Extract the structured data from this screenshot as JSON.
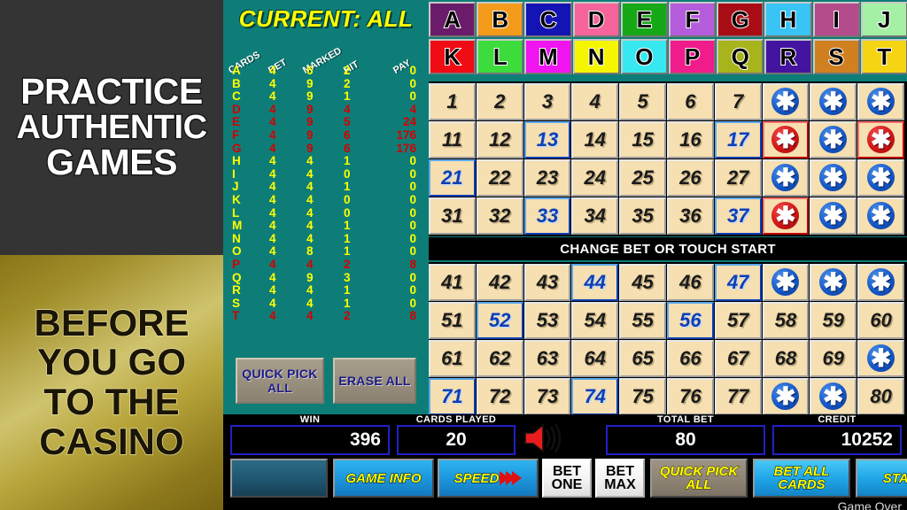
{
  "promo": {
    "top_lines": [
      "PRACTICE",
      "AUTHENTIC",
      "GAMES"
    ],
    "bottom_lines": [
      "BEFORE",
      "YOU GO",
      "TO THE",
      "CASINO"
    ],
    "top_bg": "#343434",
    "bottom_bg": "#b8a63c"
  },
  "paytable": {
    "title": "CURRENT: ALL",
    "headers": [
      "CARDS",
      "BET",
      "MARKED",
      "HIT",
      "PAY"
    ],
    "rows": [
      {
        "card": "A",
        "bet": "4",
        "marked": "6",
        "hit": "2",
        "pay": "0",
        "color": "y"
      },
      {
        "card": "B",
        "bet": "4",
        "marked": "9",
        "hit": "2",
        "pay": "0",
        "color": "y"
      },
      {
        "card": "C",
        "bet": "4",
        "marked": "9",
        "hit": "1",
        "pay": "0",
        "color": "y"
      },
      {
        "card": "D",
        "bet": "4",
        "marked": "9",
        "hit": "4",
        "pay": "4",
        "color": "r"
      },
      {
        "card": "E",
        "bet": "4",
        "marked": "9",
        "hit": "5",
        "pay": "24",
        "color": "r"
      },
      {
        "card": "F",
        "bet": "4",
        "marked": "9",
        "hit": "6",
        "pay": "176",
        "color": "r"
      },
      {
        "card": "G",
        "bet": "4",
        "marked": "9",
        "hit": "6",
        "pay": "176",
        "color": "r"
      },
      {
        "card": "H",
        "bet": "4",
        "marked": "4",
        "hit": "1",
        "pay": "0",
        "color": "y"
      },
      {
        "card": "I",
        "bet": "4",
        "marked": "4",
        "hit": "0",
        "pay": "0",
        "color": "y"
      },
      {
        "card": "J",
        "bet": "4",
        "marked": "4",
        "hit": "1",
        "pay": "0",
        "color": "y"
      },
      {
        "card": "K",
        "bet": "4",
        "marked": "4",
        "hit": "0",
        "pay": "0",
        "color": "y"
      },
      {
        "card": "L",
        "bet": "4",
        "marked": "4",
        "hit": "0",
        "pay": "0",
        "color": "y"
      },
      {
        "card": "M",
        "bet": "4",
        "marked": "4",
        "hit": "1",
        "pay": "0",
        "color": "y"
      },
      {
        "card": "N",
        "bet": "4",
        "marked": "4",
        "hit": "1",
        "pay": "0",
        "color": "y"
      },
      {
        "card": "O",
        "bet": "4",
        "marked": "8",
        "hit": "1",
        "pay": "0",
        "color": "y"
      },
      {
        "card": "P",
        "bet": "4",
        "marked": "4",
        "hit": "2",
        "pay": "8",
        "color": "r"
      },
      {
        "card": "Q",
        "bet": "4",
        "marked": "9",
        "hit": "3",
        "pay": "0",
        "color": "y"
      },
      {
        "card": "R",
        "bet": "4",
        "marked": "4",
        "hit": "1",
        "pay": "0",
        "color": "y"
      },
      {
        "card": "S",
        "bet": "4",
        "marked": "4",
        "hit": "1",
        "pay": "0",
        "color": "y"
      },
      {
        "card": "T",
        "bet": "4",
        "marked": "4",
        "hit": "2",
        "pay": "8",
        "color": "r"
      }
    ],
    "quick_pick_all": "QUICK PICK ALL",
    "erase_all": "ERASE ALL"
  },
  "letter_tiles": [
    {
      "label": "A",
      "bg": "#6a1c6a"
    },
    {
      "label": "B",
      "bg": "#f59b1c"
    },
    {
      "label": "C",
      "bg": "#1414b4"
    },
    {
      "label": "D",
      "bg": "#f5649b"
    },
    {
      "label": "E",
      "bg": "#16a816"
    },
    {
      "label": "F",
      "bg": "#b45cdc"
    },
    {
      "label": "G",
      "bg": "#a80c14"
    },
    {
      "label": "H",
      "bg": "#38c4f5"
    },
    {
      "label": "I",
      "bg": "#b44c8c"
    },
    {
      "label": "J",
      "bg": "#a4f0a4"
    },
    {
      "label": "K",
      "bg": "#f00c14"
    },
    {
      "label": "L",
      "bg": "#3cdc3c"
    },
    {
      "label": "M",
      "bg": "#f014f0"
    },
    {
      "label": "N",
      "bg": "#f5f500"
    },
    {
      "label": "O",
      "bg": "#38e8f0"
    },
    {
      "label": "P",
      "bg": "#f01c8c"
    },
    {
      "label": "Q",
      "bg": "#a8b41c"
    },
    {
      "label": "R",
      "bg": "#4414a0"
    },
    {
      "label": "S",
      "bg": "#d08020"
    },
    {
      "label": "T",
      "bg": "#f5d414"
    }
  ],
  "grid_top": [
    {
      "v": "1",
      "s": "normal"
    },
    {
      "v": "2",
      "s": "normal"
    },
    {
      "v": "3",
      "s": "normal"
    },
    {
      "v": "4",
      "s": "normal"
    },
    {
      "v": "5",
      "s": "normal"
    },
    {
      "v": "6",
      "s": "normal"
    },
    {
      "v": "7",
      "s": "normal"
    },
    {
      "v": "*",
      "s": "star"
    },
    {
      "v": "*",
      "s": "star"
    },
    {
      "v": "*",
      "s": "star"
    },
    {
      "v": "11",
      "s": "normal"
    },
    {
      "v": "12",
      "s": "normal"
    },
    {
      "v": "13",
      "s": "marked"
    },
    {
      "v": "14",
      "s": "normal"
    },
    {
      "v": "15",
      "s": "normal"
    },
    {
      "v": "16",
      "s": "normal"
    },
    {
      "v": "17",
      "s": "marked"
    },
    {
      "v": "*",
      "s": "star-red"
    },
    {
      "v": "*",
      "s": "star"
    },
    {
      "v": "*",
      "s": "star-red"
    },
    {
      "v": "21",
      "s": "marked"
    },
    {
      "v": "22",
      "s": "normal"
    },
    {
      "v": "23",
      "s": "normal"
    },
    {
      "v": "24",
      "s": "normal"
    },
    {
      "v": "25",
      "s": "normal"
    },
    {
      "v": "26",
      "s": "normal"
    },
    {
      "v": "27",
      "s": "normal"
    },
    {
      "v": "*",
      "s": "star"
    },
    {
      "v": "*",
      "s": "star"
    },
    {
      "v": "*",
      "s": "star"
    },
    {
      "v": "31",
      "s": "normal"
    },
    {
      "v": "32",
      "s": "normal"
    },
    {
      "v": "33",
      "s": "marked"
    },
    {
      "v": "34",
      "s": "normal"
    },
    {
      "v": "35",
      "s": "normal"
    },
    {
      "v": "36",
      "s": "normal"
    },
    {
      "v": "37",
      "s": "marked"
    },
    {
      "v": "*",
      "s": "star-red"
    },
    {
      "v": "*",
      "s": "star"
    },
    {
      "v": "*",
      "s": "star"
    }
  ],
  "grid_bottom": [
    {
      "v": "41",
      "s": "normal"
    },
    {
      "v": "42",
      "s": "normal"
    },
    {
      "v": "43",
      "s": "normal"
    },
    {
      "v": "44",
      "s": "marked"
    },
    {
      "v": "45",
      "s": "normal"
    },
    {
      "v": "46",
      "s": "normal"
    },
    {
      "v": "47",
      "s": "marked"
    },
    {
      "v": "*",
      "s": "star"
    },
    {
      "v": "*",
      "s": "star"
    },
    {
      "v": "*",
      "s": "star"
    },
    {
      "v": "51",
      "s": "normal"
    },
    {
      "v": "52",
      "s": "marked"
    },
    {
      "v": "53",
      "s": "normal"
    },
    {
      "v": "54",
      "s": "normal"
    },
    {
      "v": "55",
      "s": "normal"
    },
    {
      "v": "56",
      "s": "marked"
    },
    {
      "v": "57",
      "s": "normal"
    },
    {
      "v": "58",
      "s": "normal"
    },
    {
      "v": "59",
      "s": "normal"
    },
    {
      "v": "60",
      "s": "normal"
    },
    {
      "v": "61",
      "s": "normal"
    },
    {
      "v": "62",
      "s": "normal"
    },
    {
      "v": "63",
      "s": "normal"
    },
    {
      "v": "64",
      "s": "normal"
    },
    {
      "v": "65",
      "s": "normal"
    },
    {
      "v": "66",
      "s": "normal"
    },
    {
      "v": "67",
      "s": "normal"
    },
    {
      "v": "68",
      "s": "normal"
    },
    {
      "v": "69",
      "s": "normal"
    },
    {
      "v": "*",
      "s": "star"
    },
    {
      "v": "71",
      "s": "marked"
    },
    {
      "v": "72",
      "s": "normal"
    },
    {
      "v": "73",
      "s": "normal"
    },
    {
      "v": "74",
      "s": "marked"
    },
    {
      "v": "75",
      "s": "normal"
    },
    {
      "v": "76",
      "s": "normal"
    },
    {
      "v": "77",
      "s": "normal"
    },
    {
      "v": "*",
      "s": "star"
    },
    {
      "v": "*",
      "s": "star"
    },
    {
      "v": "80",
      "s": "normal"
    }
  ],
  "message_band": "CHANGE BET OR TOUCH START",
  "meters": [
    {
      "label": "WIN",
      "value": "396",
      "align": "right"
    },
    {
      "label": "CARDS PLAYED",
      "value": "20",
      "align": "center"
    },
    {
      "label": "TOTAL BET",
      "value": "80",
      "align": "center"
    },
    {
      "label": "CREDIT",
      "value": "10252",
      "align": "right"
    }
  ],
  "buttons": {
    "blank": "",
    "game_info": "GAME INFO",
    "speed": "SPEED",
    "bet_one": "BET ONE",
    "bet_max": "BET MAX",
    "quick_pick_all": "QUICK PICK ALL",
    "bet_all_cards": "BET ALL CARDS",
    "start": "START"
  },
  "status": "Game Over",
  "icons": {
    "speaker": "speaker-icon",
    "speed_arrows": "double-arrow-icon"
  }
}
